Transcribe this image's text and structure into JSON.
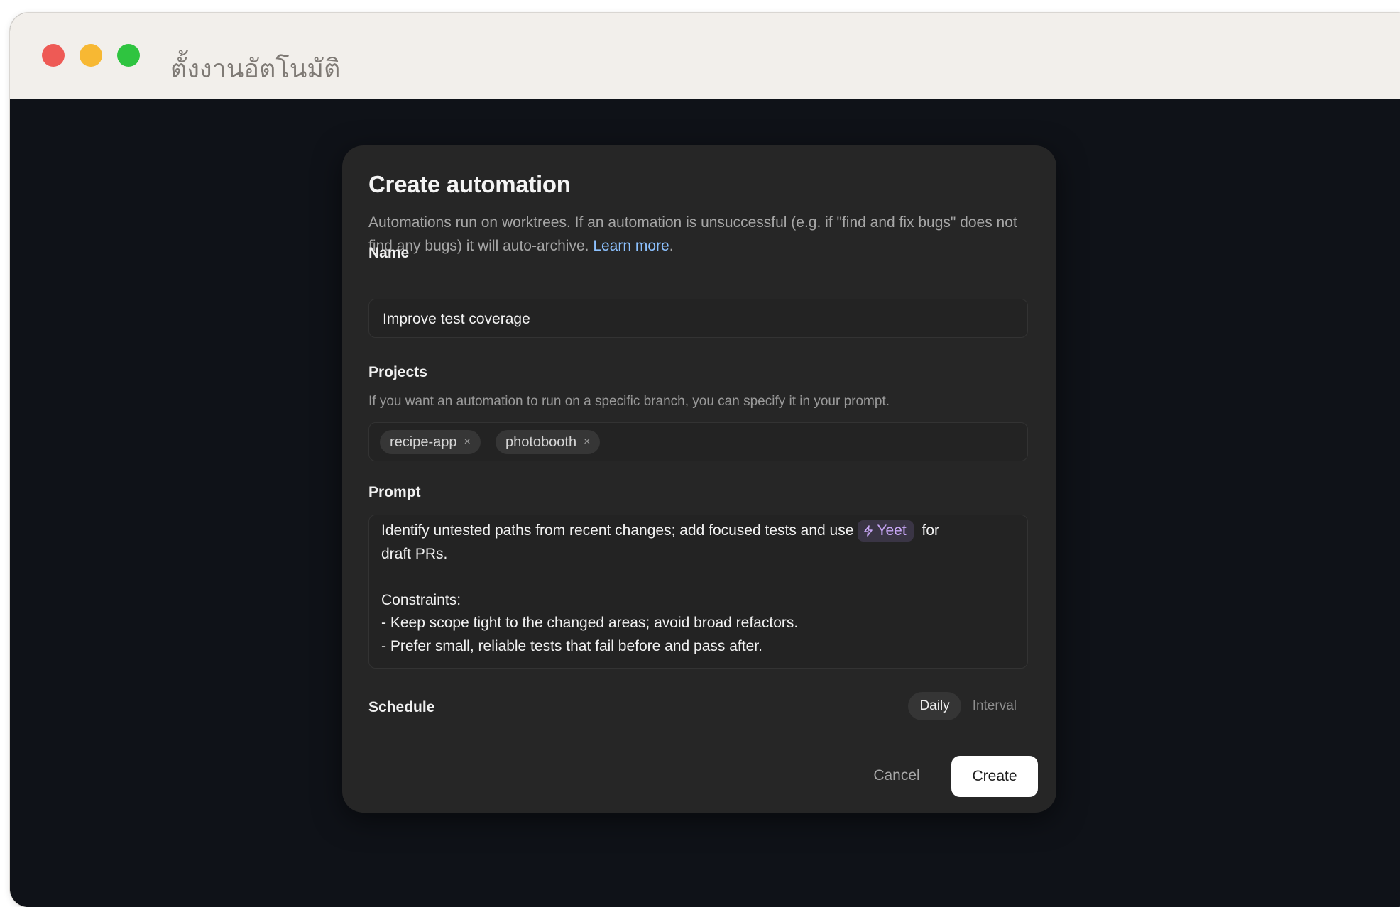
{
  "window": {
    "title": "ตั้งงานอัตโนมัติ"
  },
  "modal": {
    "title": "Create automation",
    "description": "Automations run on worktrees. If an automation is unsuccessful (e.g. if \"find and fix bugs\" does not find any bugs) it will auto-archive.",
    "learn_more": "Learn more",
    "description_end": "."
  },
  "name": {
    "label": "Name",
    "value": "Improve test coverage"
  },
  "projects": {
    "label": "Projects",
    "help": "If you want an automation to run on a specific branch, you can specify it in your prompt.",
    "chips": [
      {
        "label": "recipe-app",
        "remove": "×"
      },
      {
        "label": "photobooth",
        "remove": "×"
      }
    ]
  },
  "prompt": {
    "label": "Prompt",
    "line1_before": "Identify untested paths from recent changes; add focused tests and use",
    "skill": "Yeet",
    "line1_after": "for",
    "line2": "draft PRs.",
    "line3": "",
    "line4": "Constraints:",
    "line5": "- Keep scope tight to the changed areas; avoid broad refactors.",
    "line6": "- Prefer small, reliable tests that fail before and pass after."
  },
  "schedule": {
    "label": "Schedule",
    "options": [
      {
        "label": "Daily",
        "selected": true
      },
      {
        "label": "Interval",
        "selected": false
      }
    ]
  },
  "actions": {
    "cancel": "Cancel",
    "create": "Create"
  },
  "colors": {
    "accent_link": "#8cc1ff",
    "skill_chip_text": "#c7a6f5",
    "traffic_red": "#ee5a55",
    "traffic_yellow": "#f7b833",
    "traffic_green": "#2fc440"
  }
}
